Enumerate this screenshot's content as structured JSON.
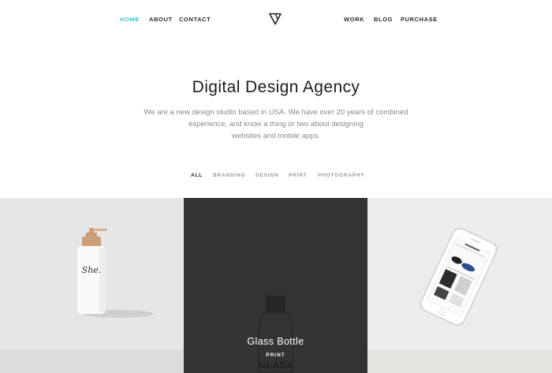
{
  "nav": {
    "left": [
      {
        "label": "HOME",
        "active": true
      },
      {
        "label": "ABOUT",
        "active": false
      },
      {
        "label": "CONTACT",
        "active": false
      }
    ],
    "right": [
      {
        "label": "WORK"
      },
      {
        "label": "BLOG"
      },
      {
        "label": "PURCHASE"
      }
    ],
    "logo_icon": "triangle-logo-icon"
  },
  "hero": {
    "title": "Digital Design Agency",
    "lines": [
      "We are a new design studio based in USA. We have over 20 years of combined",
      "experience, and know a thing or two about designing",
      "websites and mobile apps."
    ]
  },
  "filters": [
    {
      "label": "ALL",
      "active": true
    },
    {
      "label": "BRANDING",
      "active": false
    },
    {
      "label": "DESIGN",
      "active": false
    },
    {
      "label": "PRINT",
      "active": false
    },
    {
      "label": "PHOTOGRAPHY",
      "active": false
    }
  ],
  "portfolio": {
    "items": [
      {
        "image": "soap-bottle",
        "bottle_label": "She."
      },
      {
        "image": "glass-bottle",
        "title": "Glass Bottle",
        "category": "PRINT",
        "bottle_text": "GLASS"
      },
      {
        "image": "smartphone-mockup"
      }
    ]
  },
  "colors": {
    "accent": "#3cc6c6",
    "overlay": "#333333"
  }
}
